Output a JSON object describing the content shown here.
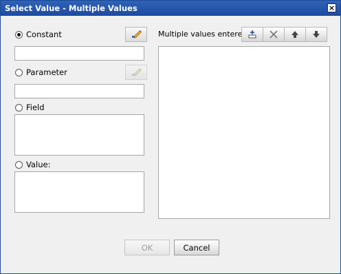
{
  "window": {
    "title": "Select Value - Multiple Values",
    "close_glyph": "×"
  },
  "left": {
    "constant_label": "Constant",
    "parameter_label": "Parameter",
    "field_label": "Field",
    "value_label": "Value:",
    "constant_value": "",
    "parameter_value": "",
    "selected": "constant"
  },
  "right": {
    "multiple_values_label": "Multiple values entered",
    "toolbar_icons": [
      "add-icon",
      "delete-icon",
      "move-up-icon",
      "move-down-icon"
    ]
  },
  "footer": {
    "ok_label": "OK",
    "cancel_label": "Cancel"
  }
}
